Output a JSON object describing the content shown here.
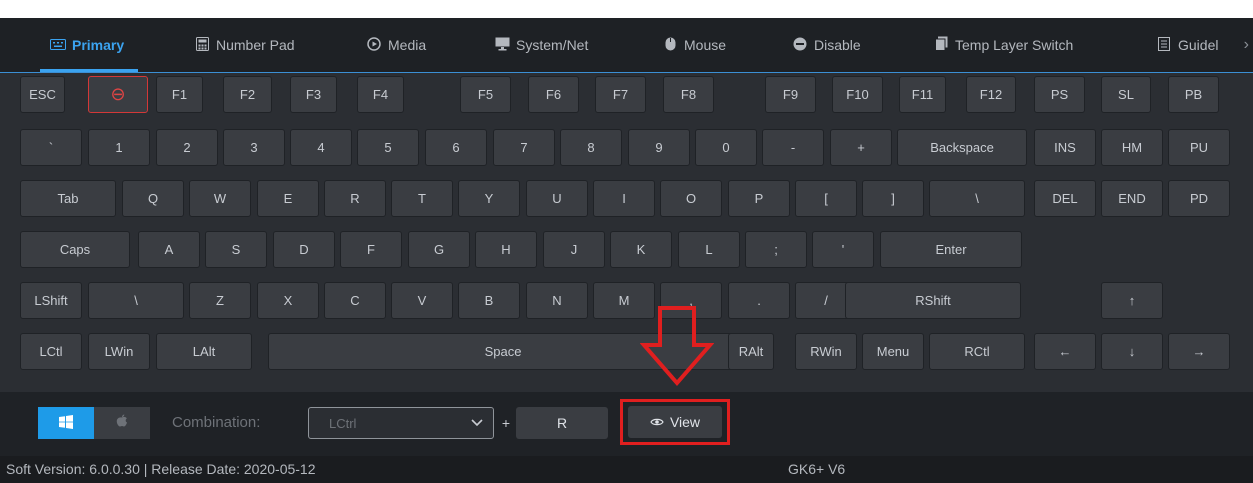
{
  "tabs": [
    {
      "label": "Primary",
      "icon": "keyboard-icon",
      "active": true
    },
    {
      "label": "Number Pad",
      "icon": "calculator-icon"
    },
    {
      "label": "Media",
      "icon": "play-circle-icon"
    },
    {
      "label": "System/Net",
      "icon": "monitor-icon"
    },
    {
      "label": "Mouse",
      "icon": "mouse-icon"
    },
    {
      "label": "Disable",
      "icon": "disable-icon"
    },
    {
      "label": "Temp Layer Switch",
      "icon": "layers-icon"
    },
    {
      "label": "Guidel",
      "icon": "document-icon"
    }
  ],
  "tabs_more": "›",
  "keyboard": {
    "rows": [
      [
        "ESC",
        "⊖",
        "F1",
        "F2",
        "F3",
        "F4",
        "F5",
        "F6",
        "F7",
        "F8",
        "F9",
        "F10",
        "F11",
        "F12",
        "PS",
        "SL",
        "PB"
      ],
      [
        "`",
        "1",
        "2",
        "3",
        "4",
        "5",
        "6",
        "7",
        "8",
        "9",
        "0",
        "-",
        "+",
        "Backspace",
        "INS",
        "HM",
        "PU"
      ],
      [
        "Tab",
        "Q",
        "W",
        "E",
        "R",
        "T",
        "Y",
        "U",
        "I",
        "O",
        "P",
        "[",
        "]",
        "\\",
        "DEL",
        "END",
        "PD"
      ],
      [
        "Caps",
        "A",
        "S",
        "D",
        "F",
        "G",
        "H",
        "J",
        "K",
        "L",
        ";",
        "'",
        "Enter"
      ],
      [
        "LShift",
        "\\",
        "Z",
        "X",
        "C",
        "V",
        "B",
        "N",
        "M",
        ",",
        ".",
        "/",
        "RShift",
        "↑"
      ],
      [
        "LCtl",
        "LWin",
        "LAlt",
        "Space",
        "RAlt",
        "RWin",
        "Menu",
        "RCtl",
        "←",
        "↓",
        "→"
      ]
    ]
  },
  "combination": {
    "os_windows_icon": "windows-icon",
    "os_mac_icon": "apple-icon",
    "label": "Combination:",
    "modifier_value": "LCtrl",
    "plus": "+",
    "key_value": "R",
    "view_label": "View"
  },
  "status": {
    "soft_version": "Soft Version: 6.0.0.30 |  Release Date: 2020-05-12",
    "device": "GK6+ V6"
  },
  "colors": {
    "accent": "#3ba3f0",
    "annotation_red": "#e01f1f",
    "key_bg": "#3a3d42",
    "panel_bg": "#2b2e33"
  }
}
